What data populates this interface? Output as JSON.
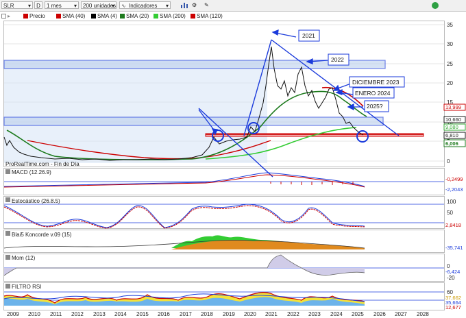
{
  "toolbar": {
    "symbol": "SLR",
    "symbol_flag": "D",
    "period": "1 mes",
    "units": "200 unidades",
    "indicators": "Indicadores"
  },
  "legend": [
    {
      "label": "Precio",
      "color": "#cc0000"
    },
    {
      "label": "SMA (40)",
      "color": "#cc0000"
    },
    {
      "label": "SMA (4)",
      "color": "#000000"
    },
    {
      "label": "SMA (20)",
      "color": "#1d7a1d"
    },
    {
      "label": "SMA (200)",
      "color": "#33cc33"
    },
    {
      "label": "SMA (120)",
      "color": "#cc0000"
    }
  ],
  "main": {
    "watermark": "ProRealTime.com - Fin de Día",
    "y_ticks": [
      "35",
      "30",
      "25",
      "20",
      "15",
      "10",
      "5",
      "0"
    ],
    "price_tags": [
      {
        "text": "13,999",
        "color": "#cc0000"
      },
      {
        "text": "10,660",
        "color": "#1a1a1a"
      },
      {
        "text": "9,080",
        "color": "#33aa33"
      },
      {
        "text": "6,810",
        "color": "#1a1a1a"
      },
      {
        "text": "6,006",
        "color": "#1d7a1d"
      }
    ],
    "annotations": [
      "2021",
      "2022",
      "DICIEMBRE 2023",
      "ENERO 2024",
      "2025?"
    ]
  },
  "panels": [
    {
      "name": "macd",
      "title": "MACD (12.26.9)",
      "tags": [
        "-0,2499",
        "-2,2043"
      ]
    },
    {
      "name": "stochastic",
      "title": "Estocástico (26.8.5)",
      "ticks": [
        "100",
        "50",
        "0"
      ],
      "tags": [
        "2,8418"
      ]
    },
    {
      "name": "koncorde",
      "title": "Blai5 Koncorde v.09 (15)",
      "tags": [
        "-35,741"
      ]
    },
    {
      "name": "momentum",
      "title": "Mom (12)",
      "ticks": [
        "0",
        "-20"
      ],
      "tags": [
        "-6,424"
      ]
    },
    {
      "name": "rsi",
      "title": "FILTRO RSI",
      "ticks": [
        "60",
        "40"
      ],
      "tags": [
        "37,662",
        "35,664",
        "12,677"
      ]
    }
  ],
  "x_axis": [
    "2009",
    "2010",
    "2011",
    "2012",
    "2013",
    "2014",
    "2015",
    "2016",
    "2017",
    "2018",
    "2019",
    "2020",
    "2021",
    "2022",
    "2023",
    "2024",
    "2025",
    "2026",
    "2027",
    "2028"
  ],
  "colors": {
    "accent_blue": "#1a3adb",
    "price_red": "#cc0000",
    "sma_green": "#33cc33"
  }
}
